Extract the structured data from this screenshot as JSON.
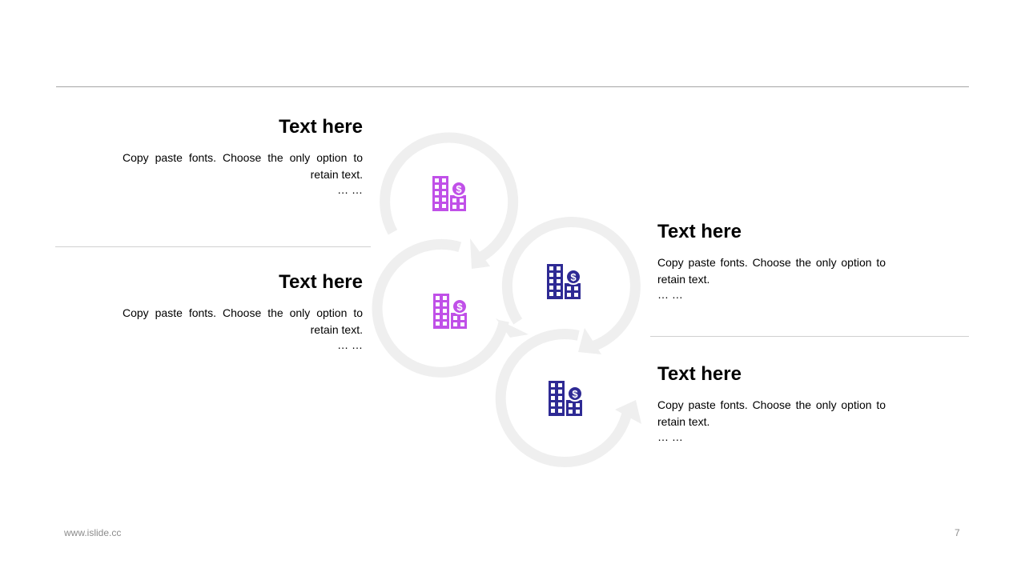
{
  "blocks": [
    {
      "title": "Text here",
      "body": "Copy paste fonts. Choose the only option to retain text.",
      "ellipsis": "… …"
    },
    {
      "title": "Text here",
      "body": "Copy paste fonts. Choose the only option to retain text.",
      "ellipsis": "… …"
    },
    {
      "title": "Text here",
      "body": "Copy paste fonts. Choose the only option to retain text.",
      "ellipsis": "… …"
    },
    {
      "title": "Text here",
      "body": "Copy paste fonts. Choose the only option to retain text.",
      "ellipsis": "… …"
    }
  ],
  "icons": [
    "building-dollar-icon",
    "building-dollar-icon",
    "building-dollar-icon",
    "building-dollar-icon"
  ],
  "colors": {
    "magenta": "#c050e8",
    "navy": "#2e2a94",
    "ring": "#efefef",
    "rule": "#a6a6a6"
  },
  "footer": {
    "website": "www.islide.cc",
    "page_number": "7"
  }
}
